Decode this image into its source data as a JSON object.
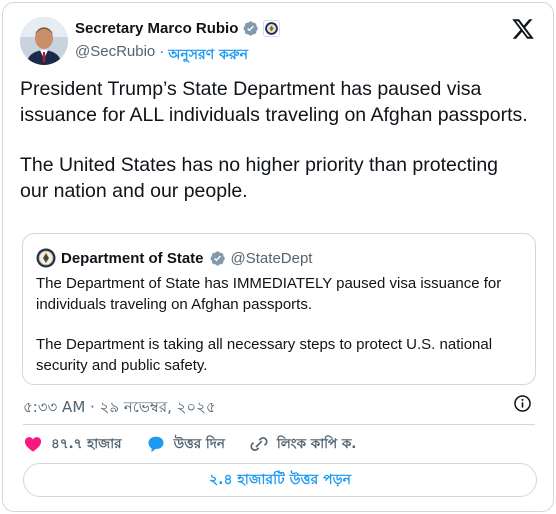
{
  "author": {
    "display_name": "Secretary Marco Rubio",
    "handle": "@SecRubio",
    "separator": "·",
    "follow_label": "অনুসরণ করুন"
  },
  "tweet": {
    "paragraphs": [
      "President Trump’s State Department has paused visa issuance for ALL individuals traveling on Afghan passports.",
      "The United States has no higher priority than protecting our nation and our people."
    ]
  },
  "quote": {
    "display_name": "Department of State",
    "handle": "@StateDept",
    "paragraphs": [
      "The Department of State has IMMEDIATELY paused visa issuance for individuals traveling on Afghan passports.",
      "The Department is taking all necessary steps to protect U.S. national security and public safety."
    ]
  },
  "timestamp": "৫:৩৩ AM · ২৯ নভেম্বর, ২০২৫",
  "actions": {
    "likes": "৪৭.৭ হাজার",
    "reply": "উত্তর দিন",
    "copy_link": "লিংক কাপি ক."
  },
  "read_replies": "২.৪ হাজারটি উত্তর পড়ন",
  "icons": {
    "verified": "verified-badge-icon",
    "seal": "government-seal-icon",
    "x_logo": "x-logo-icon",
    "info": "info-icon",
    "heart": "heart-icon",
    "reply": "speech-bubble-icon",
    "link": "link-icon"
  },
  "colors": {
    "accent": "#1d9bf0",
    "like": "#f91880",
    "secondary_text": "#536471",
    "border": "#cfd9de"
  }
}
